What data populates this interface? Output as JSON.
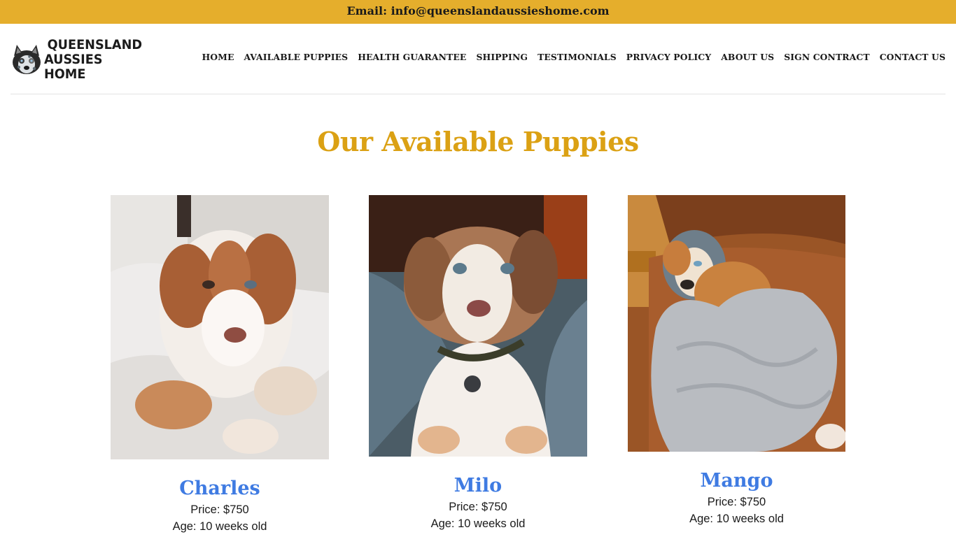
{
  "topbar": {
    "email_text": "Email: info@queenslandaussieshome.com"
  },
  "header": {
    "logo": {
      "line1": "QUEENSLAND",
      "line2": "AUSSIES HOME"
    },
    "nav": [
      {
        "label": "HOME"
      },
      {
        "label": "AVAILABLE PUPPIES"
      },
      {
        "label": "HEALTH GUARANTEE"
      },
      {
        "label": "SHIPPING"
      },
      {
        "label": "TESTIMONIALS"
      },
      {
        "label": "PRIVACY POLICY"
      },
      {
        "label": "ABOUT US"
      },
      {
        "label": "SIGN CONTRACT"
      },
      {
        "label": "CONTACT US"
      }
    ]
  },
  "main": {
    "title": "Our Available Puppies",
    "puppies": [
      {
        "name": "Charles",
        "price": "Price: $750",
        "age": "Age: 10 weeks old"
      },
      {
        "name": "Milo",
        "price": "Price: $750",
        "age": "Age: 10 weeks old"
      },
      {
        "name": "Mango",
        "price": "Price: $750",
        "age": "Age: 10 weeks old"
      }
    ]
  },
  "colors": {
    "topbar_bg": "#e5ae2c",
    "title_gold": "#dba114",
    "name_blue": "#3f7be2"
  }
}
